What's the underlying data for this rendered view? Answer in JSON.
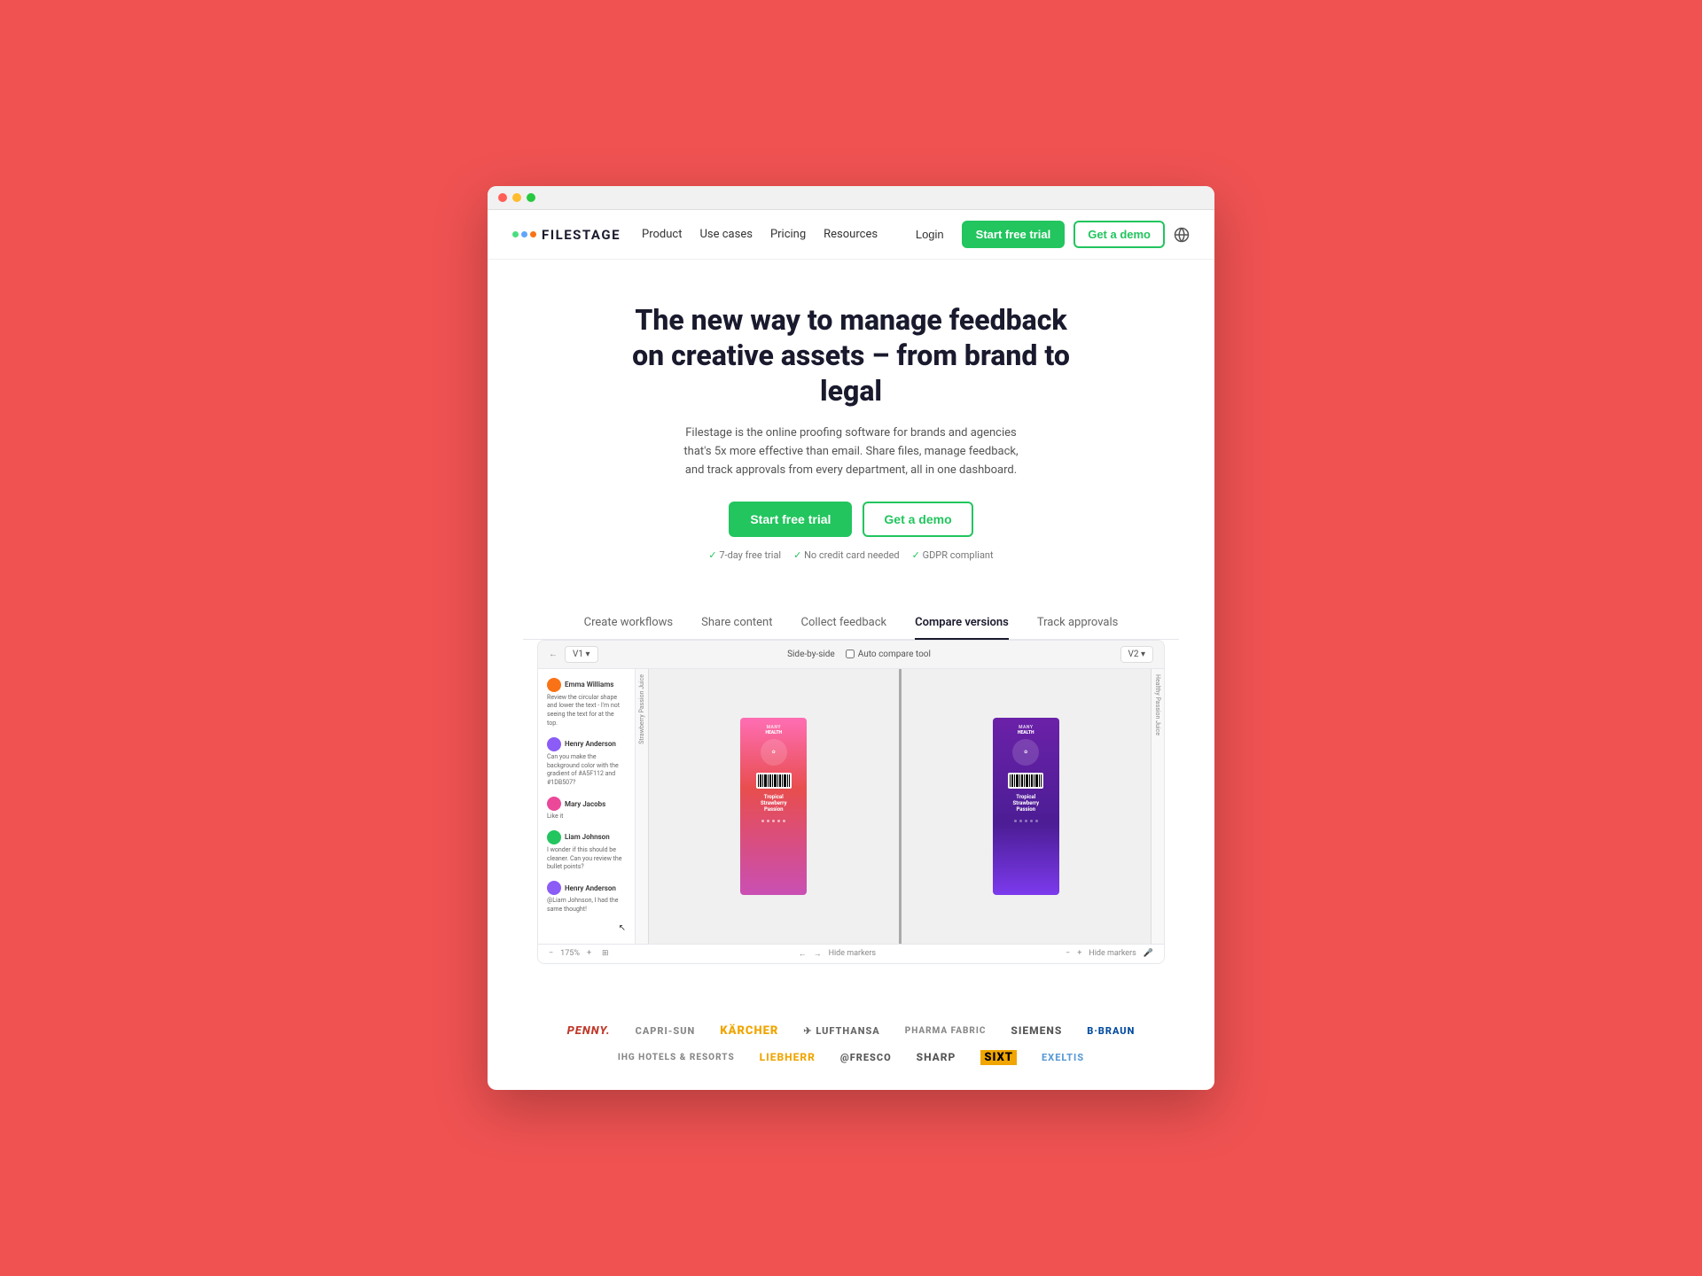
{
  "browser": {
    "dots": [
      "red",
      "yellow",
      "green"
    ]
  },
  "nav": {
    "logo_text": "FILESTAGE",
    "links": [
      {
        "label": "Product",
        "has_arrow": true
      },
      {
        "label": "Use cases",
        "has_arrow": true
      },
      {
        "label": "Pricing",
        "has_arrow": false
      },
      {
        "label": "Resources",
        "has_arrow": true
      }
    ],
    "login_label": "Login",
    "trial_label": "Start free trial",
    "demo_label": "Get a demo"
  },
  "hero": {
    "title": "The new way to manage feedback on creative assets – from brand to legal",
    "subtitle": "Filestage is the online proofing software for brands and agencies that's 5x more effective than email. Share files, manage feedback, and track approvals from every department, all in one dashboard.",
    "trial_btn": "Start free trial",
    "demo_btn": "Get a demo",
    "checks": [
      "7-day free trial",
      "No credit card needed",
      "GDPR compliant"
    ]
  },
  "tabs": [
    {
      "label": "Create workflows",
      "active": false
    },
    {
      "label": "Share content",
      "active": false
    },
    {
      "label": "Collect feedback",
      "active": false
    },
    {
      "label": "Compare versions",
      "active": true
    },
    {
      "label": "Track approvals",
      "active": false
    }
  ],
  "preview": {
    "toolbar_left": "V1 ▾",
    "toolbar_center_label": "Side-by-side",
    "toolbar_center2": "Auto compare tool",
    "toolbar_right": "V2 ▾",
    "comments": [
      {
        "name": "Emma Williams",
        "text": "Review the circular shape and lower the text - I'm not seeing the text for at the top.",
        "color": "#f97316"
      },
      {
        "name": "Henry Anderson",
        "text": "Can you make the background color with the gradient of #A5F112 and #1DB507?",
        "color": "#8b5cf6"
      },
      {
        "name": "Mary Jacobs",
        "text": "Like it",
        "color": "#ec4899"
      },
      {
        "name": "Liam Johnson",
        "text": "I wonder if this should be cleaner. Can you review the bullet points?",
        "color": "#22c55e"
      },
      {
        "name": "Henry Anderson",
        "text": "@Liam Johnson, I had the same thought!",
        "color": "#8b5cf6"
      }
    ],
    "bottom_zoom": "175%",
    "product_left": {
      "brand": "MANY HEALTH",
      "flavor": "Tropical Strawberry Passion"
    },
    "product_right": {
      "brand": "MANY HEALTH",
      "flavor": "Tropical Strawberry Passion"
    }
  },
  "logos_row1": [
    {
      "name": "PENNY.",
      "class": "penny"
    },
    {
      "name": "Capri-Sun",
      "class": "capri"
    },
    {
      "name": "KÄRCHER",
      "class": "karcher"
    },
    {
      "name": "✈ Lufthansa",
      "class": "lufthansa"
    },
    {
      "name": "Pharma Fabric",
      "class": "pharma"
    },
    {
      "name": "SIEMENS",
      "class": "siemens"
    },
    {
      "name": "B.BRAUN",
      "class": "bbraun"
    }
  ],
  "logos_row2": [
    {
      "name": "IHG HOTELS & RESORTS",
      "class": "ihg"
    },
    {
      "name": "LIEBHERR",
      "class": "liebherr"
    },
    {
      "name": "@fresco",
      "class": "afresco"
    },
    {
      "name": "SHARP",
      "class": "sharp"
    },
    {
      "name": "SIXT",
      "class": "sixt"
    },
    {
      "name": "Exeltis",
      "class": "exeltis"
    }
  ]
}
